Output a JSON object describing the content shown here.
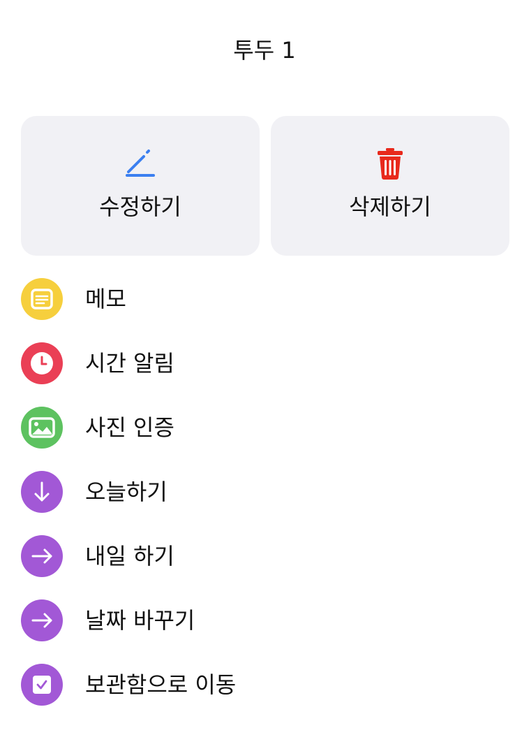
{
  "header": {
    "title": "투두 1"
  },
  "actions": {
    "edit": {
      "label": "수정하기",
      "icon": "pencil-icon",
      "color": "#3b7ff0"
    },
    "delete": {
      "label": "삭제하기",
      "icon": "trash-icon",
      "color": "#e8291c"
    }
  },
  "menu": {
    "items": [
      {
        "label": "메모",
        "icon": "memo-icon",
        "color": "#f6cf3d"
      },
      {
        "label": "시간 알림",
        "icon": "clock-icon",
        "color": "#ea3f55"
      },
      {
        "label": "사진 인증",
        "icon": "photo-icon",
        "color": "#5dc260"
      },
      {
        "label": "오늘하기",
        "icon": "arrow-down-icon",
        "color": "#a258d6"
      },
      {
        "label": "내일 하기",
        "icon": "arrow-right-icon",
        "color": "#a258d6"
      },
      {
        "label": "날짜 바꾸기",
        "icon": "arrow-right-icon",
        "color": "#a258d6"
      },
      {
        "label": "보관함으로 이동",
        "icon": "archive-check-icon",
        "color": "#a258d6"
      }
    ]
  },
  "colors": {
    "card_background": "#f1f1f5",
    "text": "#111111"
  }
}
